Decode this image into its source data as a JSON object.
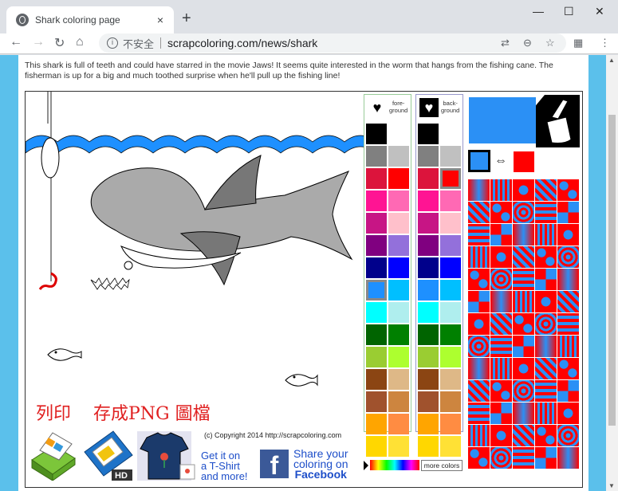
{
  "browser": {
    "tab_title": "Shark coloring page",
    "tab_close": "×",
    "new_tab": "+",
    "insecure_label": "不安全",
    "url": "scrapcoloring.com/news/shark",
    "info_glyph": "i",
    "win_min": "—",
    "win_max": "☐",
    "win_close": "✕"
  },
  "page": {
    "description": "This shark is full of teeth and could have starred in the movie Jaws! It seems quite interested in the worm that hangs from the fishing cane. The fisherman is up for a big and much toothed surprise when he'll pull up the fishing line!",
    "print_label": "列印",
    "save_label": "存成PNG 圖檔",
    "copyright": "(c) Copyright 2014 http://scrapcoloring.com",
    "tshirt_line1": "Get it on",
    "tshirt_line2": "a T-Shirt",
    "tshirt_line3": "and more!",
    "fb_line1": "Share your",
    "fb_line2": "coloring on",
    "fb_line3": "Facebook",
    "hd_label": "HD",
    "more_colors": "more colors"
  },
  "palettes": {
    "fg_label_1": "fore-",
    "fg_label_2": "ground",
    "bg_label_1": "back-",
    "bg_label_2": "ground",
    "colors": [
      "#000000",
      "#ffffff",
      "#808080",
      "#c0c0c0",
      "#dc143c",
      "#ff0000",
      "#ff1493",
      "#ff69b4",
      "#c71585",
      "#ffc0cb",
      "#800080",
      "#9370db",
      "#00008b",
      "#0000ff",
      "#1e90ff",
      "#00bfff",
      "#00ffff",
      "#afeeee",
      "#006400",
      "#008000",
      "#9acd32",
      "#adff2f",
      "#8b4513",
      "#deb887",
      "#a0522d",
      "#cd853f",
      "#ffa500",
      "#ff8c42",
      "#ffd700",
      "#ffe135"
    ],
    "fg_selected_index": 14,
    "bg_selected_index": 5
  },
  "current": {
    "foreground": "#2b90f5",
    "background": "#ff0000"
  }
}
